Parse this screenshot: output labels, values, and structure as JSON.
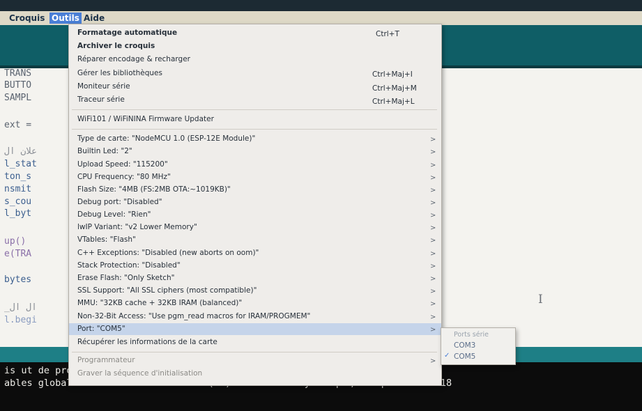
{
  "menubar": {
    "items": [
      {
        "label": "Croquis"
      },
      {
        "label": "Outils"
      },
      {
        "label": "Aide"
      }
    ]
  },
  "editor": {
    "lines": [
      "TRANS",
      "BUTTO",
      "SAMPL",
      "ext =",
      "علان ال",
      "l_stat",
      "ton_s",
      "nsmit",
      "s_cou",
      "l_byt",
      "up()",
      "e(TRA",
      "bytes",
      "_ال ال",
      "l.begi"
    ],
    "cursor_glyph": "I"
  },
  "console": {
    "lines": [
      "is ut                                                              de programmes. Le maximum e",
      "ables globales utilisent 204 octets (9%) de mémoire dynamique, ce qui laisse 18"
    ]
  },
  "tools_menu": {
    "auto_format": "Formatage automatique",
    "auto_format_shortcut": "Ctrl+T",
    "archive_sketch": "Archiver le croquis",
    "fix_encoding": "Réparer encodage & recharger",
    "manage_libraries": "Gérer les bibliothèques",
    "manage_libraries_shortcut": "Ctrl+Maj+I",
    "serial_monitor": "Moniteur série",
    "serial_monitor_shortcut": "Ctrl+Maj+M",
    "serial_plotter": "Traceur série",
    "serial_plotter_shortcut": "Ctrl+Maj+L",
    "wifi_updater": "WiFi101 / WiFiNINA Firmware Updater",
    "board_settings": [
      "Type de carte: \"NodeMCU 1.0 (ESP-12E Module)\"",
      "Builtin Led: \"2\"",
      "Upload Speed: \"115200\"",
      "CPU Frequency: \"80 MHz\"",
      "Flash Size: \"4MB (FS:2MB OTA:~1019KB)\"",
      "Debug port: \"Disabled\"",
      "Debug Level: \"Rien\"",
      "lwIP Variant: \"v2 Lower Memory\"",
      "VTables: \"Flash\"",
      "C++ Exceptions: \"Disabled (new aborts on oom)\"",
      "Stack Protection: \"Disabled\"",
      "Erase Flash: \"Only Sketch\"",
      "SSL Support: \"All SSL ciphers (most compatible)\"",
      "MMU: \"32KB cache + 32KB IRAM (balanced)\"",
      "Non-32-Bit Access: \"Use pgm_read macros for IRAM/PROGMEM\"",
      "Port: \"COM5\""
    ],
    "board_info": "Récupérer les informations de la carte",
    "programmer": "Programmateur",
    "burn_bootloader": "Graver la séquence d'initialisation",
    "arrow_glyph": ">"
  },
  "port_submenu": {
    "header": "Ports série",
    "options": [
      "COM3",
      "COM5"
    ],
    "check_glyph": "✓"
  }
}
